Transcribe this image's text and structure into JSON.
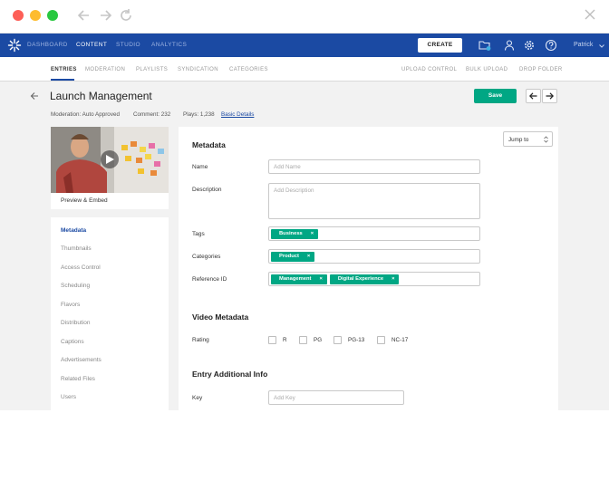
{
  "nav": {
    "items": [
      "DASHBOARD",
      "CONTENT",
      "STUDIO",
      "ANALYTICS"
    ],
    "create_label": "CREATE",
    "user": "Patrick"
  },
  "subnav": {
    "left": [
      "ENTRIES",
      "MODERATION",
      "PLAYLISTS",
      "SYNDICATION",
      "CATEGORIES"
    ],
    "right": [
      "UPLOAD CONTROL",
      "BULK UPLOAD",
      "DROP FOLDER"
    ]
  },
  "entry": {
    "title": "Launch Management",
    "moderation": "Moderation: Auto Approved",
    "comments": "Comment: 232",
    "plays": "Plays: 1,238",
    "basic_details": "Basic Details",
    "save_label": "Save"
  },
  "preview_label": "Preview & Embed",
  "sidemenu": [
    "Metadata",
    "Thumbnails",
    "Access Control",
    "Scheduling",
    "Flavors",
    "Distribution",
    "Captions",
    "Advertisements",
    "Related Files",
    "Users"
  ],
  "form": {
    "jump_to": "Jump to",
    "metadata_title": "Metadata",
    "name_label": "Name",
    "name_placeholder": "Add Name",
    "description_label": "Description",
    "description_placeholder": "Add Description",
    "tags_label": "Tags",
    "tags": [
      "Business"
    ],
    "categories_label": "Categories",
    "categories": [
      "Product"
    ],
    "reference_label": "Reference ID",
    "references": [
      "Management",
      "Digital Experience"
    ],
    "video_meta_title": "Video Metadata",
    "rating_label": "Rating",
    "ratings": [
      "R",
      "PG",
      "PG-13",
      "NC-17"
    ],
    "additional_title": "Entry Additional Info",
    "key_label": "Key",
    "key_placeholder": "Add Key"
  },
  "colors": {
    "nav_blue": "#1b4aa3",
    "accent_green": "#00a784"
  },
  "icons": [
    "back-arrow-icon",
    "forward-arrow-icon",
    "reload-icon",
    "close-icon",
    "kaltura-logo-icon",
    "folder-upload-icon",
    "user-icon",
    "gear-icon",
    "help-icon",
    "chevron-down-icon",
    "play-icon"
  ]
}
